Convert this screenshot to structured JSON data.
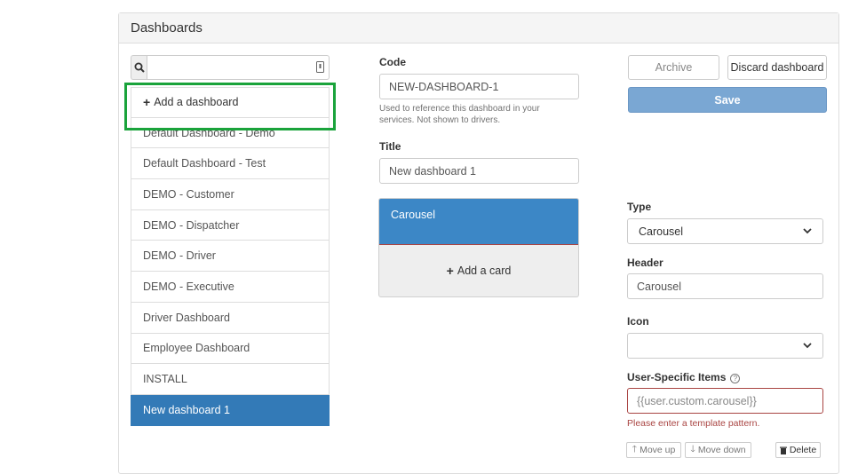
{
  "panel": {
    "title": "Dashboards"
  },
  "search": {
    "value": "",
    "placeholder": ""
  },
  "list": {
    "add_label": "Add a dashboard",
    "items": [
      "Default Dashboard - Demo",
      "Default Dashboard - Test",
      "DEMO - Customer",
      "DEMO - Dispatcher",
      "DEMO - Driver",
      "DEMO - Executive",
      "Driver Dashboard",
      "Employee Dashboard",
      "INSTALL",
      "New dashboard 1"
    ],
    "active_item": "New dashboard 1"
  },
  "form": {
    "code_label": "Code",
    "code_value": "NEW-DASHBOARD-1",
    "code_help_line1": "Used to reference this dashboard in your",
    "code_help_line2": "services. Not shown to drivers.",
    "title_label": "Title",
    "title_value": "New dashboard 1"
  },
  "cards": {
    "active_card": "Carousel",
    "add_card_label": "Add a card"
  },
  "actions": {
    "archive_label": "Archive",
    "discard_label": "Discard dashboard",
    "save_label": "Save"
  },
  "card_editor": {
    "type_label": "Type",
    "type_value": "Carousel",
    "header_label": "Header",
    "header_value": "Carousel",
    "icon_label": "Icon",
    "icon_value": "",
    "user_items_label": "User-Specific Items",
    "user_items_value": "{{user.custom.carousel}}",
    "user_items_error": "Please enter a template pattern.",
    "move_up_label": "Move up",
    "move_down_label": "Move down",
    "delete_label": "Delete"
  },
  "colors": {
    "active_blue": "#337ab7",
    "card_blue": "#3c87c6",
    "save_blue": "#7aa7d3",
    "highlight_green": "#1aa33b",
    "error_red": "#a94442"
  }
}
